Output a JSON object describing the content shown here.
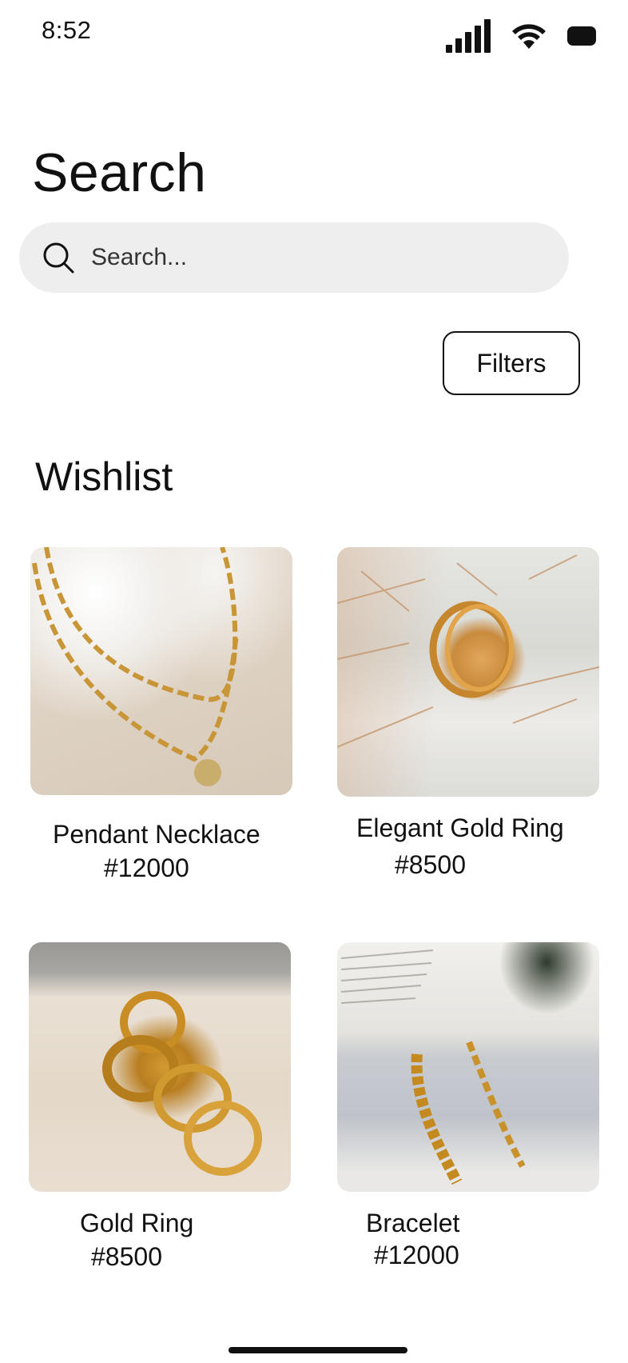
{
  "status_bar": {
    "time": "8:52"
  },
  "header": {
    "title": "Search"
  },
  "search": {
    "placeholder": "Search...",
    "icon": "search-icon"
  },
  "filters": {
    "label": "Filters"
  },
  "wishlist": {
    "title": "Wishlist",
    "items": [
      {
        "name": "Pendant Necklace",
        "price": "#12000"
      },
      {
        "name": "Elegant Gold Ring",
        "price": "#8500"
      },
      {
        "name": "Gold Ring",
        "price": "#8500"
      },
      {
        "name": "Bracelet",
        "price": "#12000"
      }
    ]
  },
  "colors": {
    "search_bg": "#efeeee",
    "text": "#111111",
    "gold": "#d4a23a"
  }
}
